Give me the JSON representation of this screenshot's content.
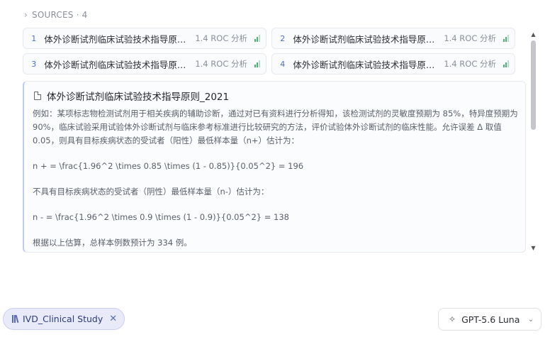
{
  "sources": {
    "header": "SOURCES · 4",
    "items": [
      {
        "num": "1",
        "title": "体外诊断试剂临床试验技术指导原则...",
        "section": "1.4 ROC 分析"
      },
      {
        "num": "2",
        "title": "体外诊断试剂临床试验技术指导原则...",
        "section": "1.4 ROC 分析"
      },
      {
        "num": "3",
        "title": "体外诊断试剂临床试验技术指导原则...",
        "section": "1.4 ROC 分析"
      },
      {
        "num": "4",
        "title": "体外诊断试剂临床试验技术指导原则...",
        "section": "1.4 ROC 分析"
      }
    ]
  },
  "panel": {
    "title": "体外诊断试剂临床试验技术指导原则_2021",
    "paragraphs": [
      "例如：某项标志物检测试剂用于相关疾病的辅助诊断，通过对已有资料进行分析得知，该检测试剂的灵敏度预期为 85%，特异度预期为 90%，临床试验采用试验体外诊断试剂与临床参考标准进行比较研究的方法，评价试验体外诊断试剂的临床性能。允许误差 Δ 取值 0.05，则具有目标疾病状态的受试者（阳性）最低样本量（n+）估计为：",
      "n + = \\frac{1.96^2 \\times 0.85 \\times (1 - 0.85)}{0.05^2} = 196",
      "不具有目标疾病状态的受试者（阴性）最低样本量（n-）估计为：",
      "n - = \\frac{1.96^2 \\times 0.9 \\times (1 - 0.9)}{0.05^2} = 138",
      "根据以上估算，总样本例数预计为 334 例。"
    ]
  },
  "footer": {
    "tag_label": "IVD_Clinical Study",
    "model_label": "GPT-5.6 Luna"
  }
}
